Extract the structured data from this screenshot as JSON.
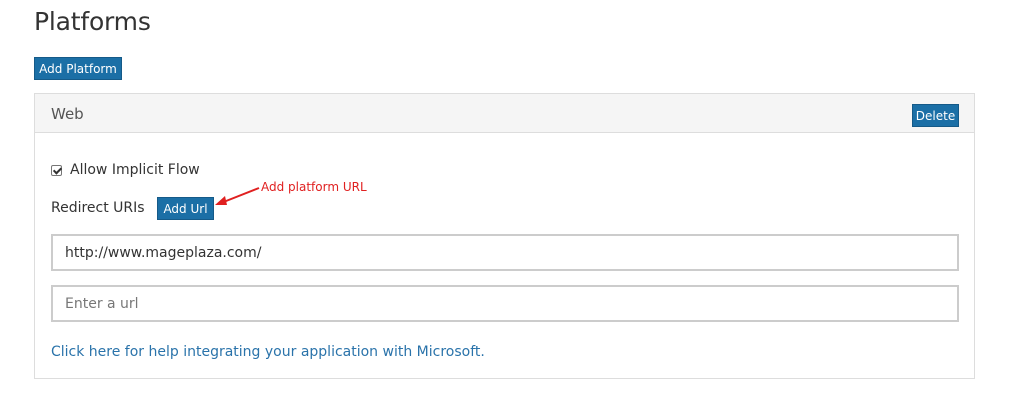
{
  "page": {
    "title": "Platforms",
    "add_platform_label": "Add Platform"
  },
  "panel": {
    "title": "Web",
    "delete_label": "Delete",
    "implicit_flow": {
      "label": "Allow Implicit Flow",
      "checked": true
    },
    "redirect": {
      "label": "Redirect URIs",
      "add_url_label": "Add Url"
    },
    "annotation": {
      "text": "Add platform URL",
      "color": "#e02020"
    },
    "url_inputs": [
      {
        "value": "http://www.mageplaza.com/",
        "placeholder": ""
      },
      {
        "value": "",
        "placeholder": "Enter a url"
      }
    ],
    "help_link": "Click here for help integrating your application with Microsoft."
  },
  "colors": {
    "button_bg": "#1b6fa6",
    "link": "#2a73aa",
    "panel_header_bg": "#f5f5f5",
    "border": "#dddddd"
  }
}
